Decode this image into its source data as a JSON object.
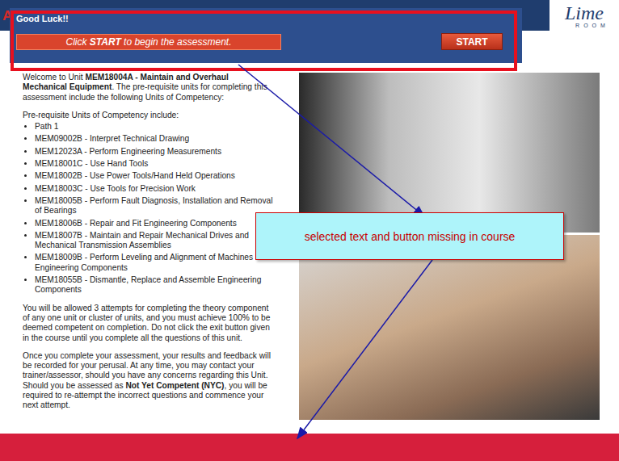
{
  "header": {
    "corner_logo": "A",
    "logo": {
      "text": "Lime",
      "subtext": "ROOM"
    }
  },
  "dialog": {
    "title": "Good Luck!!",
    "prompt": [
      {
        "text": "Click ",
        "bold": false
      },
      {
        "text": "START",
        "bold": true
      },
      {
        "text": " to begin the assessment.",
        "bold": false
      }
    ],
    "button": "START"
  },
  "content": {
    "intro": [
      {
        "text": "Welcome to Unit ",
        "bold": false
      },
      {
        "text": "MEM18004A - Maintain and Overhaul Mechanical Equipment",
        "bold": true
      },
      {
        "text": ". The pre-requisite units for completing this assessment include the following Units of Competency:",
        "bold": false
      }
    ],
    "prerequisites_heading": "Pre-requisite Units of Competency include:",
    "prerequisites": [
      "Path 1",
      "MEM09002B - Interpret Technical Drawing",
      "MEM12023A - Perform Engineering Measurements",
      "MEM18001C - Use Hand Tools",
      "MEM18002B - Use Power Tools/Hand Held Operations",
      "MEM18003C - Use Tools for Precision Work",
      "MEM18005B - Perform Fault Diagnosis, Installation and Removal of Bearings",
      "MEM18006B - Repair and Fit Engineering Components",
      "MEM18007B - Maintain and Repair Mechanical Drives and Mechanical Transmission Assemblies",
      "MEM18009B - Perform Leveling and Alignment of Machines and Engineering Components",
      "MEM18055B - Dismantle, Replace and Assemble Engineering Components"
    ],
    "paragraphs": [
      [
        {
          "text": "You will be allowed 3 attempts for completing the theory component of any one unit or cluster of units, and you must achieve 100% to be deemed competent on completion. Do not click the exit button given in the course until you complete all the questions of this unit.",
          "bold": false
        }
      ],
      [
        {
          "text": "Once you complete your assessment, your results and feedback will be recorded for your perusal. At any time, you may contact your trainer/assessor, should you have any concerns regarding this Unit. Should you be assessed as ",
          "bold": false
        },
        {
          "text": "Not Yet Competent (NYC)",
          "bold": true
        },
        {
          "text": ", you will be required to re-attempt the incorrect questions and commence your next attempt.",
          "bold": false
        }
      ]
    ]
  },
  "annotation": {
    "text": "selected text and button missing in course"
  }
}
